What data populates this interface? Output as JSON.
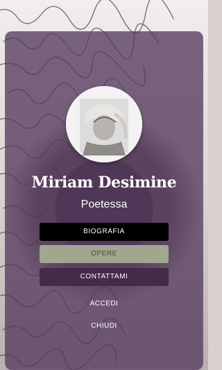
{
  "profile": {
    "name": "Miriam Desimine",
    "role": "Poetessa"
  },
  "menu": {
    "biografia": "BIOGRAFIA",
    "opere": "OPERE",
    "contattami": "CONTATTAMI"
  },
  "links": {
    "accedi": "ACCEDI",
    "chiudi": "CHIUDI"
  },
  "colors": {
    "card": "#563B5E",
    "button_active": "#000000",
    "button_opere": "#9FA78F",
    "button_contatti": "#452A4A"
  }
}
